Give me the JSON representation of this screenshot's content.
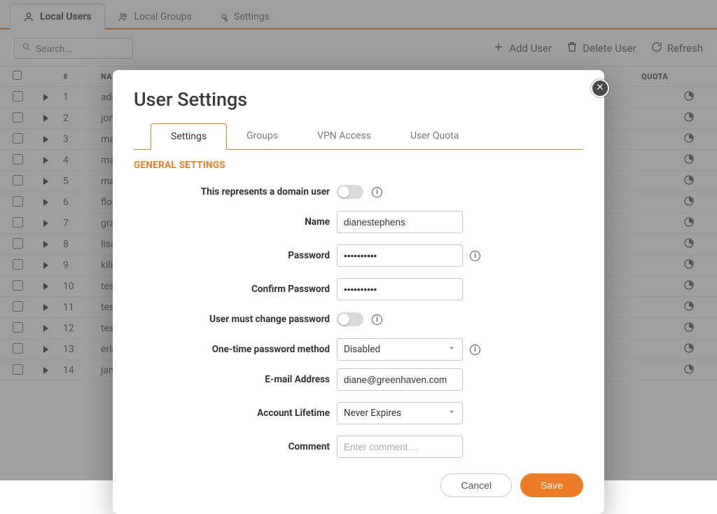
{
  "topTabs": [
    {
      "label": "Local Users",
      "active": true
    },
    {
      "label": "Local Groups",
      "active": false
    },
    {
      "label": "Settings",
      "active": false
    }
  ],
  "search": {
    "placeholder": "Search..."
  },
  "actions": {
    "add": "Add User",
    "delete": "Delete User",
    "refresh": "Refresh"
  },
  "gridHeaders": {
    "num": "#",
    "name": "NAME",
    "quota": "QUOTA"
  },
  "rows": [
    {
      "n": "1",
      "name": "adamth"
    },
    {
      "n": "2",
      "name": "jonasste"
    },
    {
      "n": "3",
      "name": "maxisbe"
    },
    {
      "n": "4",
      "name": "marekh"
    },
    {
      "n": "5",
      "name": "martinh"
    },
    {
      "n": "6",
      "name": "florianp"
    },
    {
      "n": "7",
      "name": "gracem"
    },
    {
      "n": "8",
      "name": "lisaheis"
    },
    {
      "n": "9",
      "name": "kiliandr"
    },
    {
      "n": "10",
      "name": "testuser"
    },
    {
      "n": "11",
      "name": "testuser"
    },
    {
      "n": "12",
      "name": "testuser"
    },
    {
      "n": "13",
      "name": "ericsutt"
    },
    {
      "n": "14",
      "name": "janasan"
    }
  ],
  "dialog": {
    "title": "User Settings",
    "tabs": [
      {
        "label": "Settings",
        "active": true
      },
      {
        "label": "Groups",
        "active": false
      },
      {
        "label": "VPN Access",
        "active": false
      },
      {
        "label": "User Quota",
        "active": false
      }
    ],
    "section": "GENERAL SETTINGS",
    "labels": {
      "domainUser": "This represents a domain user",
      "name": "Name",
      "password": "Password",
      "confirm": "Confirm Password",
      "mustChange": "User must change password",
      "otpMethod": "One-time password method",
      "email": "E-mail Address",
      "accountLifetime": "Account Lifetime",
      "comment": "Comment"
    },
    "values": {
      "name": "dianestephens",
      "password": "••••••••••",
      "confirm": "••••••••••",
      "otp": "Disabled",
      "email": "diane@greenhaven.com",
      "lifetime": "Never Expires",
      "commentPlaceholder": "Enter comment ..."
    },
    "buttons": {
      "cancel": "Cancel",
      "save": "Save"
    }
  }
}
